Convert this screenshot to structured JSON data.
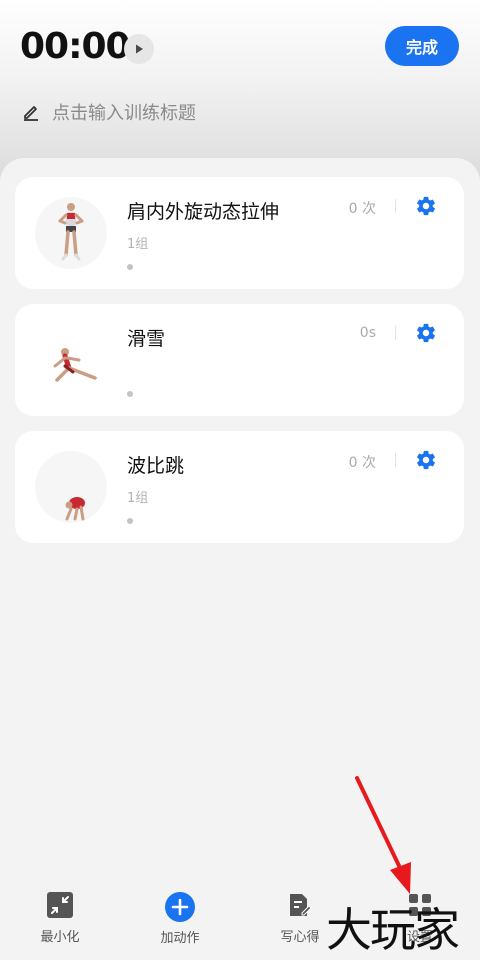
{
  "header": {
    "timer": "00:00",
    "done_label": "完成",
    "title_placeholder": "点击输入训练标题"
  },
  "exercises": [
    {
      "name": "肩内外旋动态拉伸",
      "sets": "1组",
      "count": "0 次"
    },
    {
      "name": "滑雪",
      "sets": "",
      "count": "0s"
    },
    {
      "name": "波比跳",
      "sets": "1组",
      "count": "0 次"
    }
  ],
  "bottom_nav": [
    {
      "label": "最小化",
      "icon": "minimize-icon"
    },
    {
      "label": "加动作",
      "icon": "add-icon"
    },
    {
      "label": "写心得",
      "icon": "note-edit-icon"
    },
    {
      "label": "设置",
      "icon": "settings-icon"
    }
  ],
  "watermark": "大玩家",
  "colors": {
    "accent": "#1a73f0",
    "annotation_arrow": "#e8191c"
  }
}
